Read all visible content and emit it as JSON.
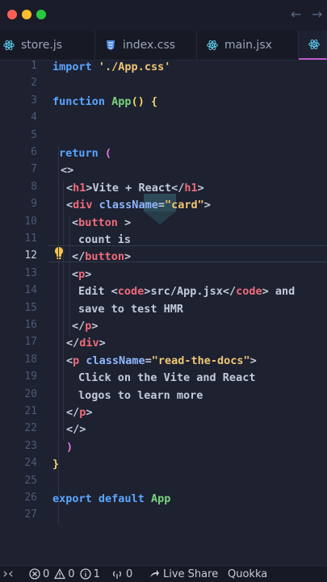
{
  "window": {
    "traffic_lights": {
      "close": "#fe5f57",
      "minimize": "#febc2e",
      "maximize": "#28c840"
    },
    "nav_back_glyph": "←",
    "nav_forward_glyph": "→"
  },
  "tabs": [
    {
      "label": "store.js",
      "icon": "react-icon"
    },
    {
      "label": "index.css",
      "icon": "css-icon"
    },
    {
      "label": "main.jsx",
      "icon": "react-icon"
    },
    {
      "label": "",
      "icon": "react-icon",
      "active": true
    }
  ],
  "editor": {
    "current_line": 12,
    "line_numbers": [
      "1",
      "2",
      "3",
      "4",
      "5",
      "6",
      "7",
      "8",
      "9",
      "10",
      "11",
      "12",
      "13",
      "14",
      "15",
      "16",
      "17",
      "18",
      "19",
      "20",
      "21",
      "22",
      "23",
      "24",
      "25",
      "26",
      "27"
    ],
    "code_tokens": {
      "l1_import": "import",
      "l1_str": "'./App.css'",
      "l3_function": "function",
      "l3_name": "App",
      "l3_paren": "()",
      "l3_brace": "{",
      "l6_return": "return",
      "l6_paren": "(",
      "l7_frag": "<>",
      "l8_open": "<",
      "l8_tag": "h1",
      "l8_close": ">",
      "l8_text": "Vite + React",
      "l8_end_open": "</",
      "l8_end_tag": "h1",
      "l8_end_close": ">",
      "l9_open": "<",
      "l9_tag": "div",
      "l9_attr": "className",
      "l9_eq": "=",
      "l9_val": "\"card\"",
      "l9_close": ">",
      "l10_open": "<",
      "l10_tag": "button",
      "l10_close": ">",
      "l11_text": "count is",
      "l12_open": "</",
      "l12_tag": "button",
      "l12_close": ">",
      "l13_open": "<",
      "l13_tag": "p",
      "l13_close": ">",
      "l14_text1": "Edit ",
      "l14_o1": "<",
      "l14_t1": "code",
      "l14_c1": ">",
      "l14_text2": "src/App.jsx",
      "l14_o2": "</",
      "l14_t2": "code",
      "l14_c2": ">",
      "l14_text3": " and",
      "l15_text": "save to test HMR",
      "l16_open": "</",
      "l16_tag": "p",
      "l16_close": ">",
      "l17_open": "</",
      "l17_tag": "div",
      "l17_close": ">",
      "l18_open": "<",
      "l18_tag": "p",
      "l18_attr": "className",
      "l18_eq": "=",
      "l18_val": "\"read-the-docs\"",
      "l18_close": ">",
      "l19_text": "Click on the Vite and React",
      "l20_text": "logos to learn more",
      "l21_open": "</",
      "l21_tag": "p",
      "l21_close": ">",
      "l22_frag": "</>",
      "l23_paren": ")",
      "l24_brace": "}",
      "l26_export": "export",
      "l26_default": "default",
      "l26_name": "App"
    }
  },
  "statusbar": {
    "remote_glyph": "⟩⟨",
    "errors": "0",
    "warnings": "0",
    "info": "1",
    "ports": "0",
    "live_share": "Live Share",
    "quokka": "Quokka"
  },
  "colors": {
    "keyword": "#5aa5ff",
    "function": "#7ad37f",
    "string": "#f0c674",
    "tag": "#f06b7a",
    "attribute": "#8fb7ff",
    "active_tab_border": "#c05bd0"
  }
}
